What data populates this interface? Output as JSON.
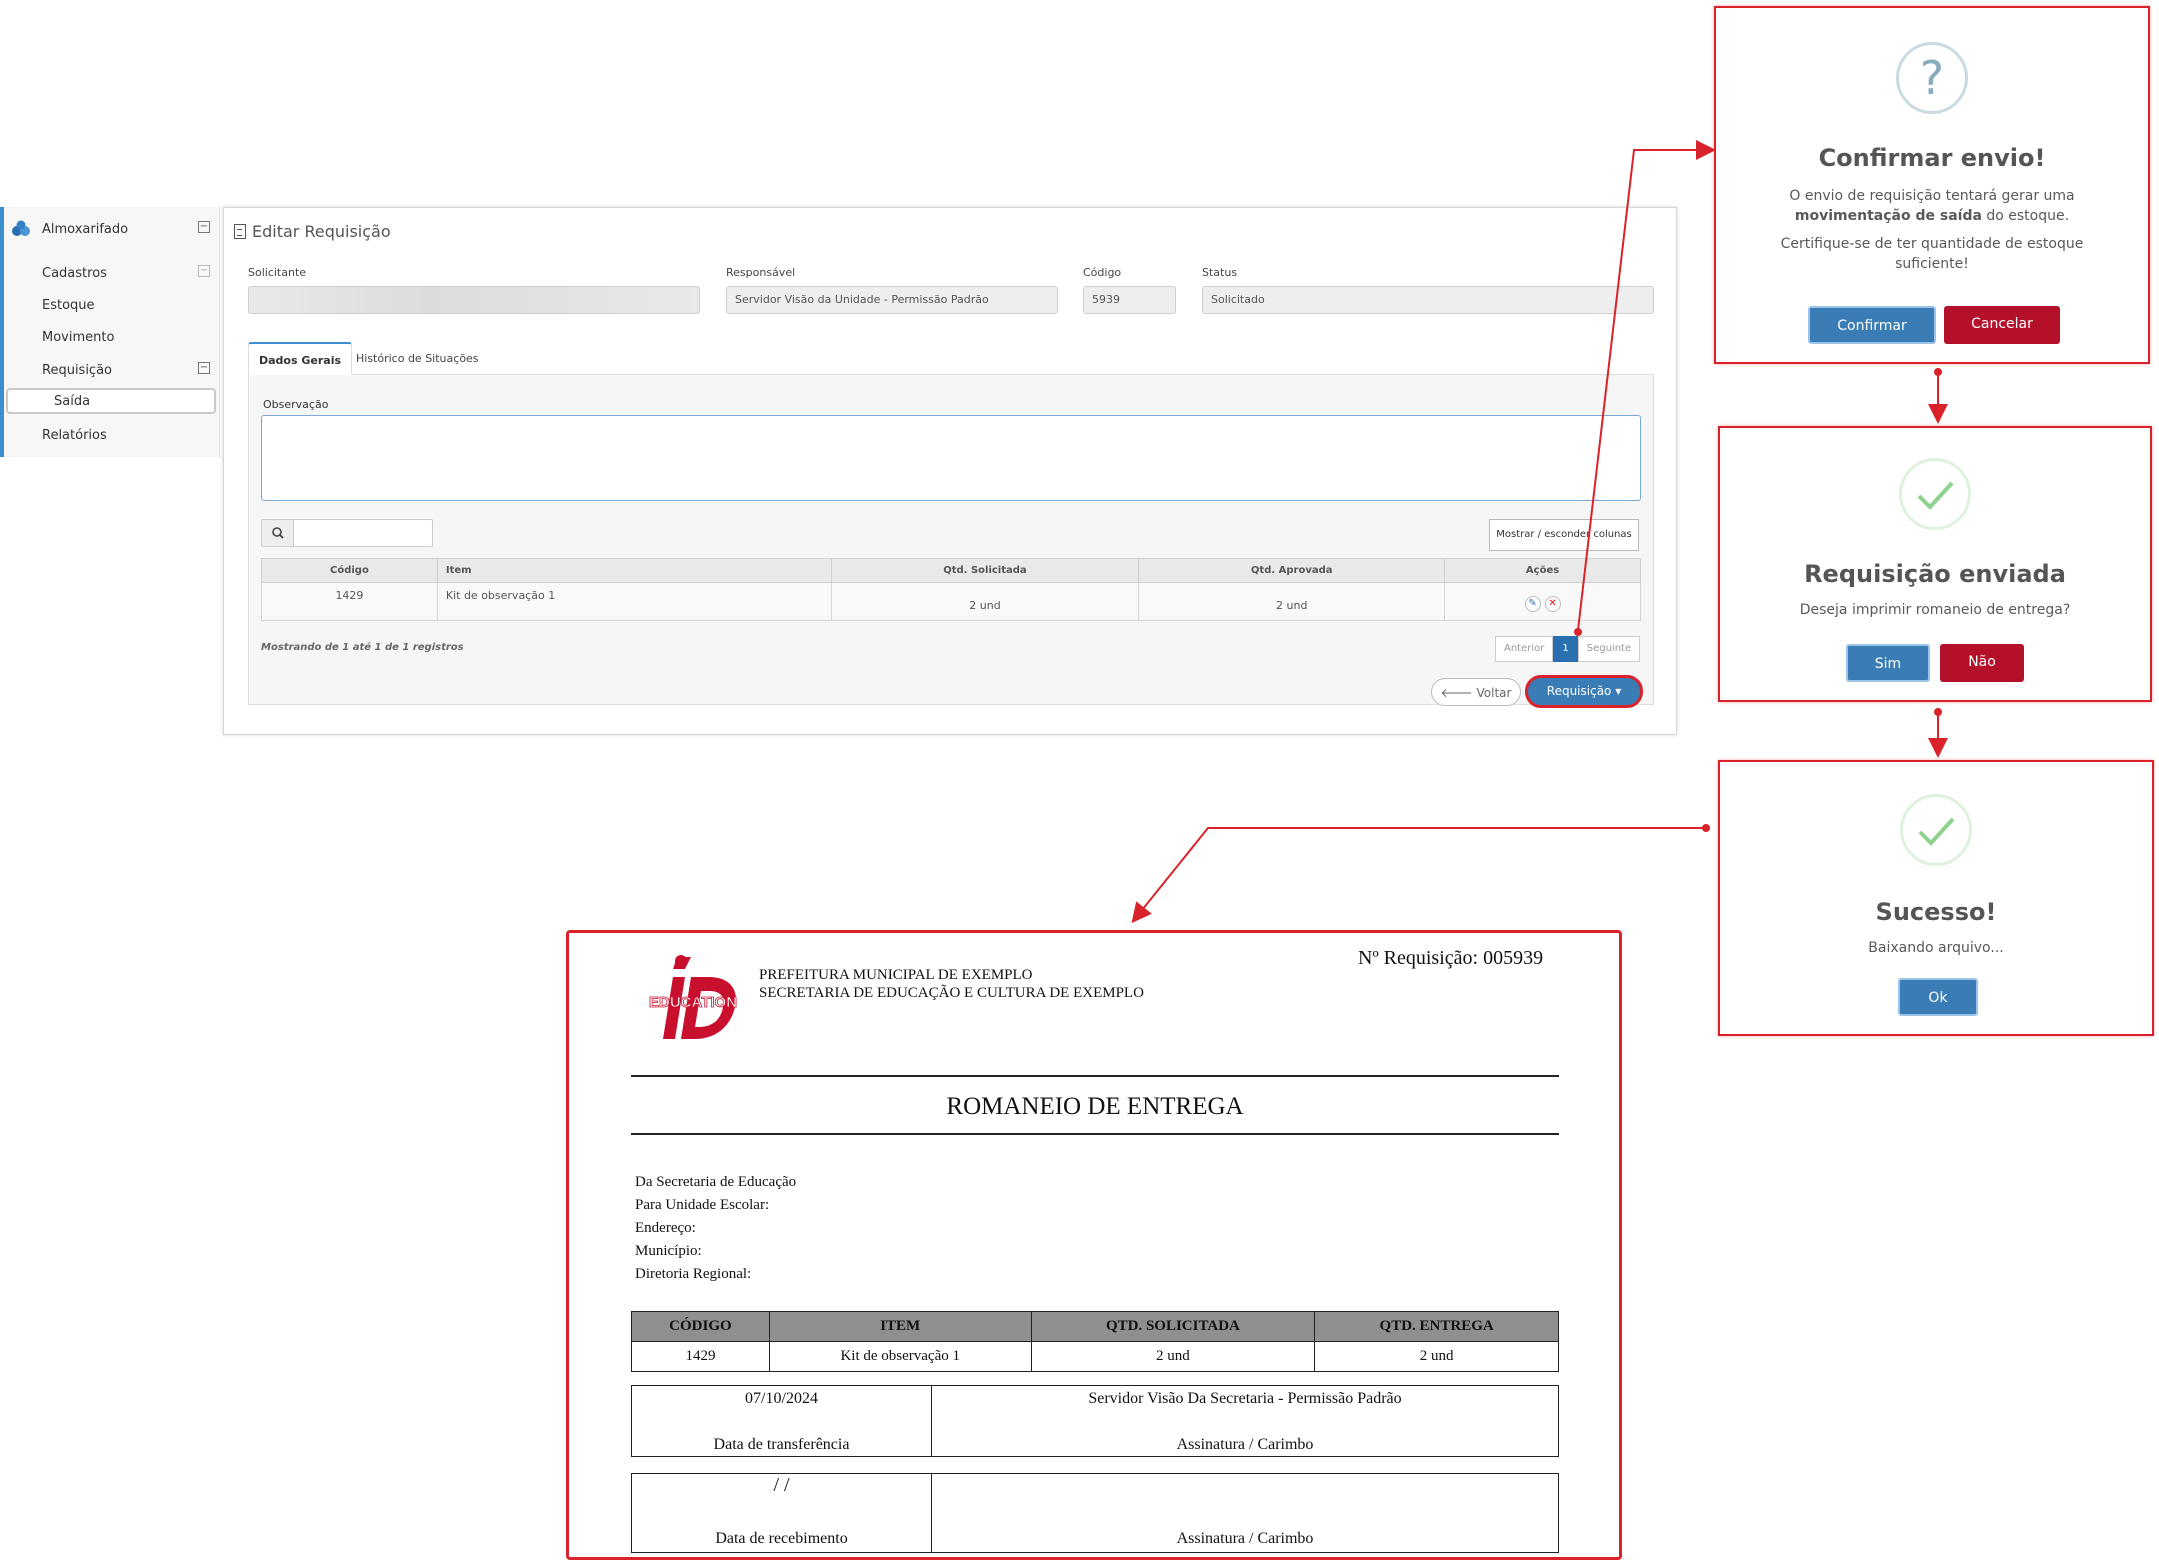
{
  "sidebar": {
    "head": "Almoxarifado",
    "items": [
      "Cadastros",
      "Estoque",
      "Movimento",
      "Requisição",
      "Saída",
      "Relatórios"
    ]
  },
  "panel": {
    "title": "Editar Requisição",
    "fields": {
      "solicitante_label": "Solicitante",
      "solicitante_value": "",
      "responsavel_label": "Responsável",
      "responsavel_value": "Servidor Visão da Unidade - Permissão Padrão",
      "codigo_label": "Código",
      "codigo_value": "5939",
      "status_label": "Status",
      "status_value": "Solicitado"
    },
    "tabs": [
      "Dados Gerais",
      "Histórico de Situações"
    ],
    "observacao_label": "Observação",
    "show_hide_columns": "Mostrar / esconder colunas",
    "table": {
      "headers": [
        "Código",
        "Item",
        "Qtd. Solicitada",
        "Qtd. Aprovada",
        "Ações"
      ],
      "rows": [
        {
          "codigo": "1429",
          "item": "Kit de observação 1",
          "qtd_solicitada": "2 und",
          "qtd_aprovada": "2 und"
        }
      ]
    },
    "showing": "Mostrando de 1 até 1 de 1 registros",
    "pager": {
      "prev": "Anterior",
      "current": "1",
      "next": "Seguinte"
    },
    "btn_voltar": "Voltar",
    "btn_requisicao": "Requisição"
  },
  "dialog_confirm": {
    "icon": "?",
    "title": "Confirmar envio!",
    "line1a": "O envio de requisição tentará gerar uma",
    "line1b_bold": "movimentação de saída",
    "line1c": " do estoque.",
    "line2a": "Certifique-se de ter quantidade de estoque",
    "line2b": "suficiente!",
    "confirm": "Confirmar",
    "cancel": "Cancelar"
  },
  "dialog_sent": {
    "title": "Requisição enviada",
    "text": "Deseja imprimir romaneio de entrega?",
    "yes": "Sim",
    "no": "Não"
  },
  "dialog_success": {
    "title": "Sucesso!",
    "text": "Baixando arquivo...",
    "ok": "Ok"
  },
  "report": {
    "logo_text": "EDUCATION",
    "org1": "PREFEITURA MUNICIPAL DE EXEMPLO",
    "org2": "SECRETARIA DE EDUCAÇÃO E CULTURA DE EXEMPLO",
    "numero": "Nº Requisição: 005939",
    "title": "ROMANEIO DE ENTREGA",
    "info": [
      "Da Secretaria de Educação",
      "Para Unidade Escolar:",
      "Endereço:",
      "Município:",
      "Diretoria Regional:"
    ],
    "headers": [
      "CÓDIGO",
      "ITEM",
      "QTD. SOLICITADA",
      "QTD. ENTREGA"
    ],
    "rows": [
      {
        "codigo": "1429",
        "item": "Kit de observação 1",
        "qtd_solicitada": "2 und",
        "qtd_entrega": "2 und"
      }
    ],
    "transfer_date": "07/10/2024",
    "transfer_date_label": "Data de transferência",
    "transfer_signer": "Servidor Visão Da Secretaria - Permissão Padrão",
    "signature_label": "Assinatura / Carimbo",
    "receive_date": "/        /",
    "receive_date_label": "Data de recebimento"
  },
  "colors": {
    "accent": "#3b8fcf",
    "primary_button": "#3a7cb6",
    "danger": "#b5102a",
    "highlight": "#d9222a",
    "success": "#8ed28e"
  }
}
